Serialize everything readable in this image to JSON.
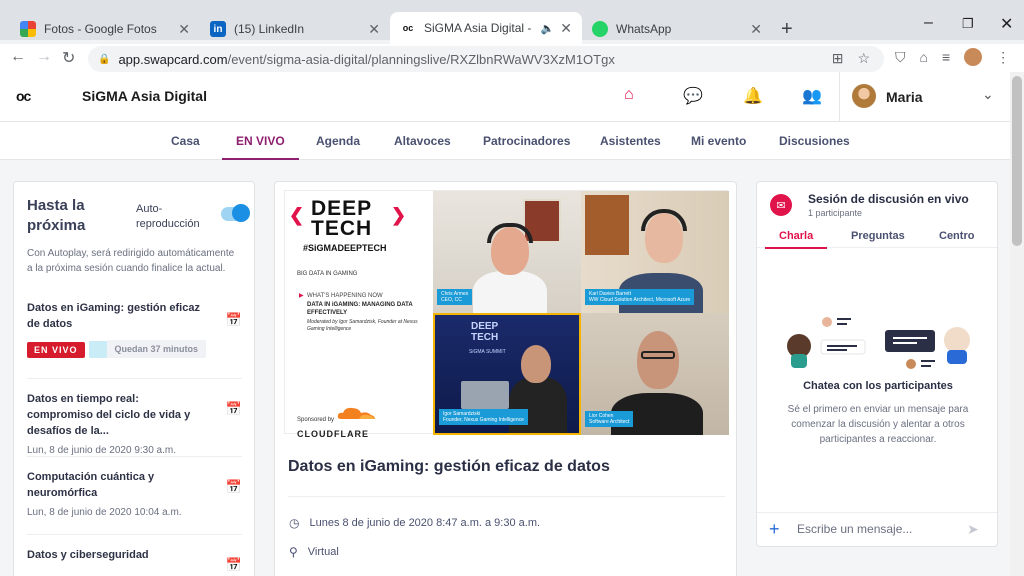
{
  "browser": {
    "tabs": [
      {
        "title": "Fotos - Google Fotos",
        "icon": "google-photos-icon"
      },
      {
        "title": "(15) LinkedIn",
        "icon": "linkedin-icon"
      },
      {
        "title": "SiGMA Asia Digital - Meet th",
        "icon": "swapcard-icon"
      },
      {
        "title": "WhatsApp",
        "icon": "whatsapp-icon"
      }
    ],
    "url_host": "app.swapcard.com",
    "url_path": "/event/sigma-asia-digital/planningslive/RXZlbnRWaWV3XzM1OTgx"
  },
  "app": {
    "logo_text": "oc",
    "event_name": "SiGMA Asia Digital",
    "user_name": "Maria",
    "nav_tabs": [
      "Casa",
      "EN VIVO",
      "Agenda",
      "Altavoces",
      "Patrocinadores",
      "Asistentes",
      "Mi evento",
      "Discusiones"
    ]
  },
  "left": {
    "title": "Hasta la próxima",
    "autoplay_label": "Auto-reproducción",
    "autoplay_on": true,
    "autoplay_desc": "Con Autoplay, será redirigido automáticamente a la próxima sesión cuando finalice la actual.",
    "live_badge": "EN VIVO",
    "remaining": "Quedan 37 minutos",
    "sessions": [
      {
        "title": "Datos en iGaming: gestión eficaz de datos",
        "date": ""
      },
      {
        "title": "Datos en tiempo real: compromiso del ciclo de vida y desafíos de la...",
        "date": "Lun, 8 de junio de 2020 9:30 a.m."
      },
      {
        "title": "Computación cuántica y neuromórfica",
        "date": "Lun, 8 de junio de 2020 10:04 a.m."
      },
      {
        "title": "Datos y ciberseguridad",
        "date": ""
      }
    ]
  },
  "video": {
    "brand_top": "DEEP",
    "brand_bottom": "TECH",
    "hashtag": "#SiGMADEEPTECH",
    "big_data": "BIG DATA IN GAMING",
    "whats_happening": "WHAT'S HAPPENING NOW",
    "happening_title": "DATA IN iGAMING: MANAGING DATA EFFECTIVELY",
    "moderator": "Moderated by Igor Samardzisk, Founder at Nexus Gaming Intelligence",
    "sponsored_by": "Sponsored by",
    "sponsor": "CLOUDFLARE",
    "participants": [
      {
        "name": "Chris Armes",
        "role": "CEO, CC"
      },
      {
        "name": "Karl Davies Barrett",
        "role": "WW Cloud Solution Architect, Microsoft Azure"
      },
      {
        "name": "Igor Samardziski",
        "role": "Founder, Nexus Gaming Intelligence"
      },
      {
        "name": "Lior Cohen",
        "role": "Software Architect"
      }
    ]
  },
  "session": {
    "title": "Datos en iGaming: gestión eficaz de datos",
    "datetime": "Lunes 8 de junio de 2020 8:47 a.m. a 9:30 a.m.",
    "location": "Virtual"
  },
  "chat": {
    "title": "Sesión de discusión en vivo",
    "participants": "1 participante",
    "tabs": [
      "Charla",
      "Preguntas",
      "Centro"
    ],
    "empty_title": "Chatea con los participantes",
    "empty_desc": "Sé el primero en enviar un mensaje para comenzar la discusión y alentar a otros participantes a reaccionar.",
    "placeholder": "Escribe un mensaje..."
  },
  "colors": {
    "accent": "#e0134a",
    "nav_active": "#8e1e6e",
    "toggle": "#1a8fe3"
  }
}
